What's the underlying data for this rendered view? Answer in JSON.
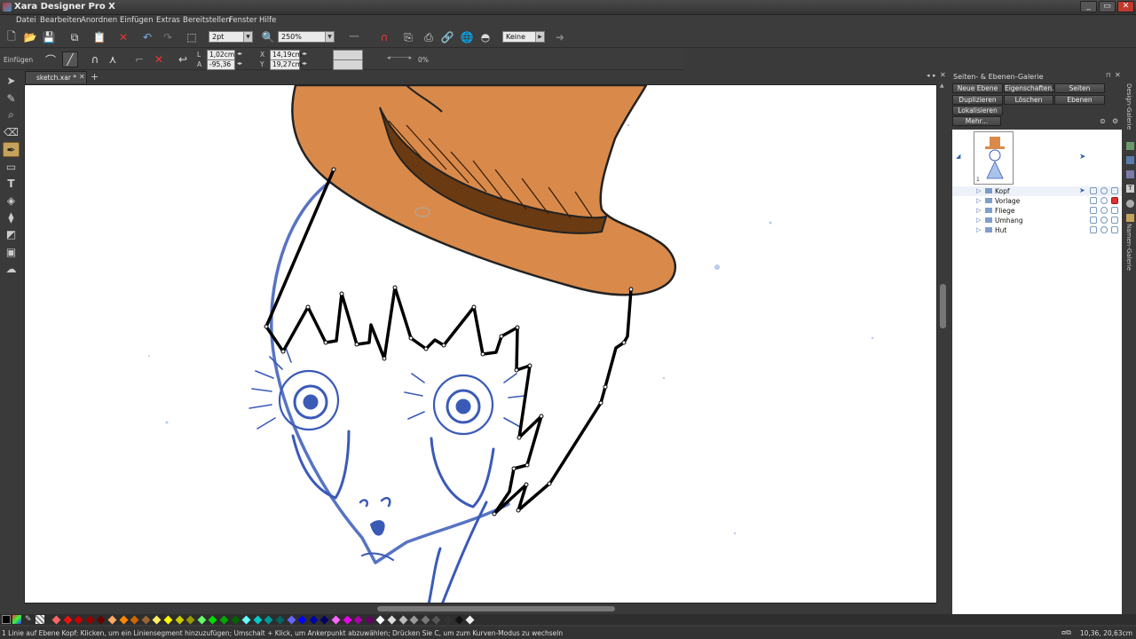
{
  "window": {
    "title": "Xara Designer Pro X",
    "minimize": "_",
    "maximize": "▭",
    "close": "✕"
  },
  "menu": [
    "Datei",
    "Bearbeiten",
    "Anordnen",
    "Einfügen",
    "Extras",
    "Bereitstellen",
    "Fenster",
    "Hilfe"
  ],
  "toolbar": {
    "line_width": "2pt",
    "zoom": "250%",
    "blend_mode": "Keine"
  },
  "infobar": {
    "mode_label": "Einfügen",
    "length_label": "L",
    "angle_label": "A",
    "length_value": "1,02cm",
    "angle_value": "-95,36",
    "x_label": "X",
    "y_label": "Y",
    "x_value": "14,19cm",
    "y_value": "19,27cm",
    "transparency_value": "0%"
  },
  "tabs": [
    {
      "label": "sketch.xar *",
      "close": "✕"
    }
  ],
  "gallery": {
    "title": "Seiten- & Ebenen-Galerie",
    "buttons": {
      "new_layer": "Neue Ebene",
      "properties": "Eigenschaften...",
      "pages": "Seiten",
      "duplicate": "Duplizieren",
      "delete": "Löschen",
      "layers": "Ebenen",
      "localize": "Lokalisieren",
      "more": "Mehr..."
    },
    "page_number": "1",
    "layers": [
      {
        "name": "Kopf",
        "locked": false
      },
      {
        "name": "Vorlage",
        "locked": true
      },
      {
        "name": "Fliege",
        "locked": false
      },
      {
        "name": "Umhang",
        "locked": false
      },
      {
        "name": "Hut",
        "locked": false
      }
    ]
  },
  "side_tabs": [
    "Design-Galerie",
    "Namen-Galerie"
  ],
  "status": {
    "text": "1 Linie auf Ebene Kopf: Klicken, um ein Liniensegment hinzuzufügen; Umschalt + Klick, um Ankerpunkt abzuwählen; Drücken Sie C, um zum Kurven-Modus zu wechseln",
    "coords": "10,36, 20,63cm"
  },
  "colors": {
    "hat": "#d98a4a",
    "hat_band": "#6a3a12",
    "sketch": "#2a4aa8",
    "accent": "#c5a25d"
  }
}
